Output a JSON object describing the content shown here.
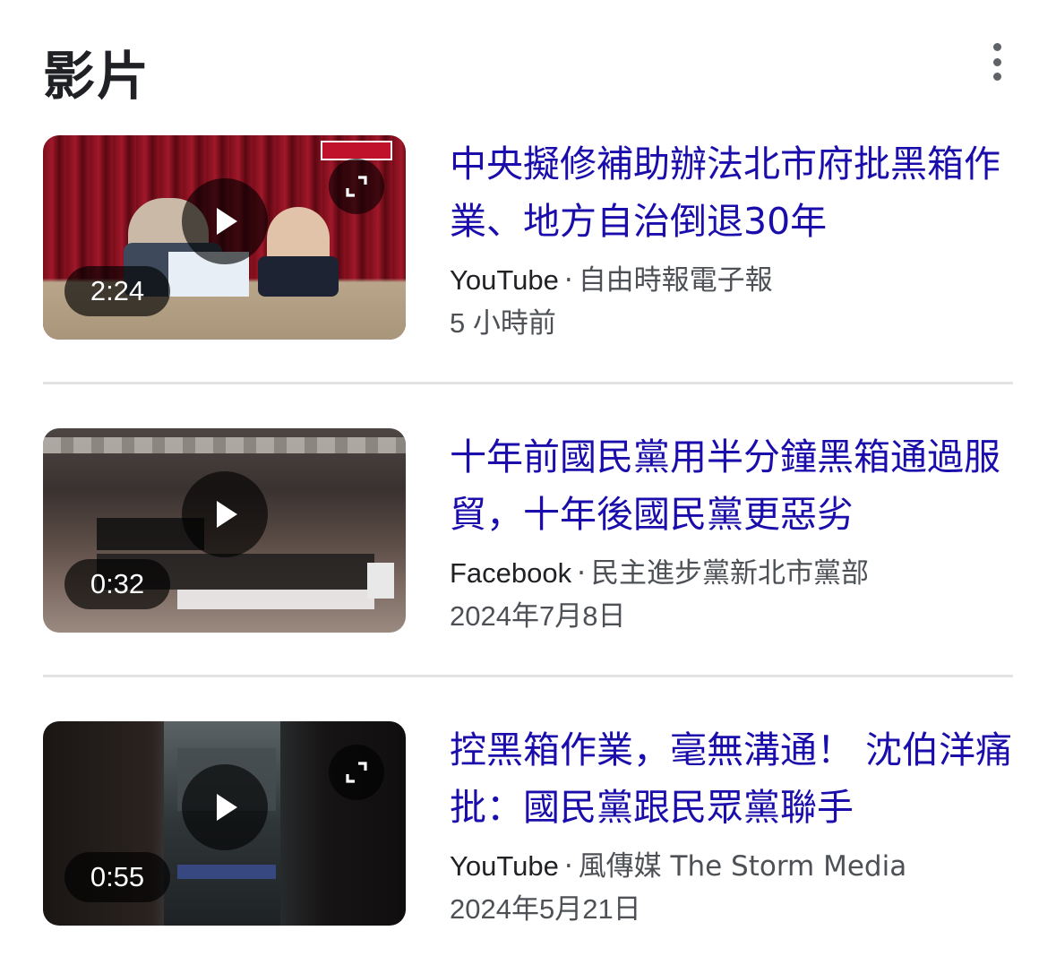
{
  "section": {
    "title": "影片",
    "menu_icon": "more-vert-icon"
  },
  "videos": [
    {
      "title": "中央擬修補助辦法北市府批黑箱作業、地方自治倒退30年",
      "duration": "2:24",
      "source": "YouTube",
      "separator": "·",
      "channel": "自由時報電子報",
      "date": "5 小時前",
      "has_expand": true
    },
    {
      "title": "十年前國民黨用半分鐘黑箱通過服貿，十年後國民黨更惡劣",
      "duration": "0:32",
      "source": "Facebook",
      "separator": "·",
      "channel": "民主進步黨新北市黨部",
      "date": "2024年7月8日",
      "has_expand": false
    },
    {
      "title": "控黑箱作業，毫無溝通！ 沈伯洋痛批：國民黨跟民眾黨聯手",
      "duration": "0:55",
      "source": "YouTube",
      "separator": "·",
      "channel": "風傳媒 The Storm Media",
      "date": "2024年5月21日",
      "has_expand": true
    }
  ],
  "colors": {
    "link": "#1a0dab",
    "meta": "#4d5156",
    "divider": "#e3e3e3"
  }
}
